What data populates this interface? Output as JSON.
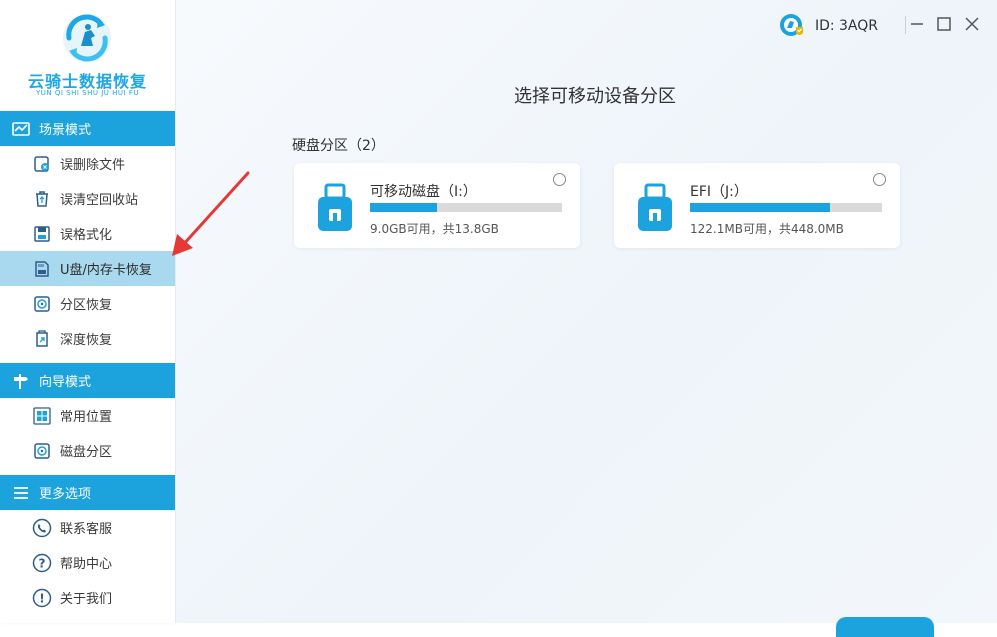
{
  "app": {
    "logo_title": "云骑士数据恢复",
    "logo_subtitle": "YUN QI SHI SHU JU HUI FU"
  },
  "sidebar": {
    "sections": [
      {
        "title": "场景模式",
        "icon": "scene-mode-icon",
        "items": [
          {
            "label": "误删除文件",
            "icon": "deleted-file-icon"
          },
          {
            "label": "误清空回收站",
            "icon": "recycle-bin-icon"
          },
          {
            "label": "误格式化",
            "icon": "format-disk-icon"
          },
          {
            "label": "U盘/内存卡恢复",
            "icon": "sd-card-icon",
            "active": true
          },
          {
            "label": "分区恢复",
            "icon": "partition-icon"
          },
          {
            "label": "深度恢复",
            "icon": "deep-scan-icon"
          }
        ]
      },
      {
        "title": "向导模式",
        "icon": "signpost-icon",
        "items": [
          {
            "label": "常用位置",
            "icon": "windows-icon"
          },
          {
            "label": "磁盘分区",
            "icon": "disk-partition-icon"
          }
        ]
      },
      {
        "title": "更多选项",
        "icon": "menu-icon",
        "items": [
          {
            "label": "联系客服",
            "icon": "phone-icon"
          },
          {
            "label": "帮助中心",
            "icon": "help-icon"
          },
          {
            "label": "关于我们",
            "icon": "info-icon"
          }
        ]
      }
    ]
  },
  "topbar": {
    "user_id": "ID: 3AQR",
    "avatar_icon": "user-avatar-icon",
    "window_buttons": [
      "minimize-icon",
      "maximize-icon",
      "close-icon"
    ]
  },
  "main": {
    "page_title": "选择可移动设备分区",
    "group_title": "硬盘分区（2）",
    "devices": [
      {
        "name": "可移动磁盘（I:）",
        "size_text": "9.0GB可用，共13.8GB",
        "used_fraction": 0.35,
        "icon": "usb-drive-icon"
      },
      {
        "name": "EFI（J:）",
        "size_text": "122.1MB可用，共448.0MB",
        "used_fraction": 0.73,
        "icon": "usb-drive-icon"
      }
    ]
  },
  "colors": {
    "accent": "#1ca3dd",
    "active_item": "#a9d9ee",
    "arrow": "#e53935"
  }
}
